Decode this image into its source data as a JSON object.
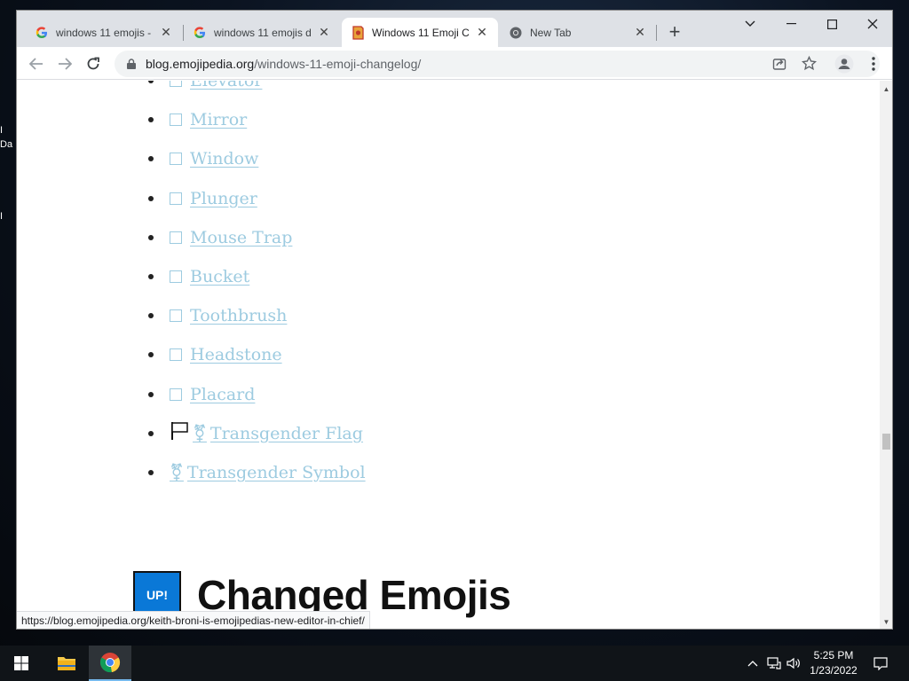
{
  "desktop": {
    "frag1": "I",
    "frag2": "Da",
    "frag3": "I"
  },
  "browser": {
    "tabs": [
      {
        "title": "windows 11 emojis -",
        "icon": "google-icon",
        "active": false
      },
      {
        "title": "windows 11 emojis d",
        "icon": "google-icon",
        "active": false
      },
      {
        "title": "Windows 11 Emoji C",
        "icon": "emojipedia-icon",
        "active": true
      },
      {
        "title": "New Tab",
        "icon": "chrome-icon",
        "active": false
      }
    ],
    "url_domain": "blog.emojipedia.org",
    "url_path": "/windows-11-emoji-changelog/",
    "status_url": "https://blog.emojipedia.org/keith-broni-is-emojipedias-new-editor-in-chief/"
  },
  "page": {
    "list_items": [
      {
        "glyph": "box",
        "label": "Elevator"
      },
      {
        "glyph": "box",
        "label": "Mirror"
      },
      {
        "glyph": "box",
        "label": "Window"
      },
      {
        "glyph": "box",
        "label": "Plunger"
      },
      {
        "glyph": "box",
        "label": "Mouse Trap"
      },
      {
        "glyph": "box",
        "label": "Bucket"
      },
      {
        "glyph": "box",
        "label": "Toothbrush"
      },
      {
        "glyph": "box",
        "label": "Headstone"
      },
      {
        "glyph": "box",
        "label": "Placard"
      },
      {
        "glyph": "flag-trans",
        "label": "Transgender Flag"
      },
      {
        "glyph": "trans",
        "label": "Transgender Symbol"
      }
    ],
    "section_badge": "UP!",
    "section_heading": "Changed Emojis",
    "link_color": "#9dcbe0",
    "badge_color": "#0a78d7"
  },
  "taskbar": {
    "time": "5:25 PM",
    "date": "1/23/2022"
  }
}
